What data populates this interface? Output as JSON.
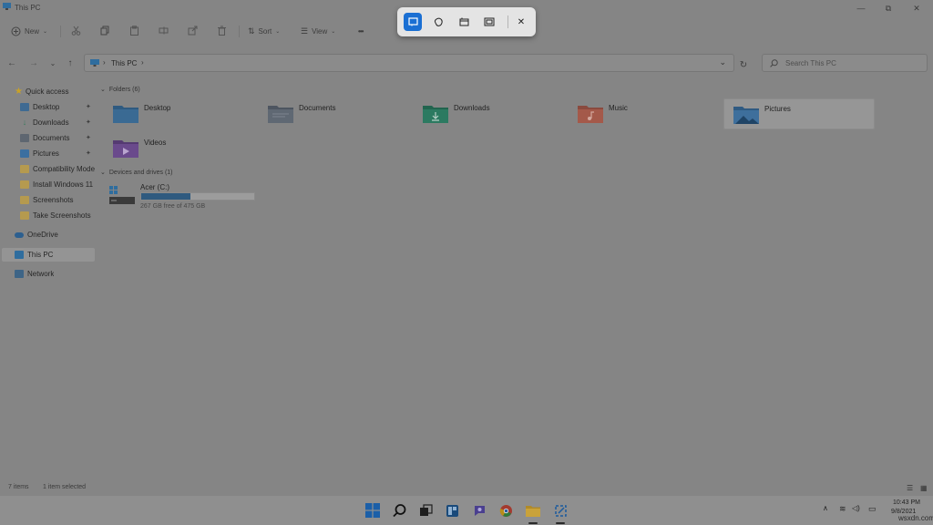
{
  "window": {
    "title": "This PC",
    "minimize_glyph": "—",
    "maximize_glyph": "⧉",
    "close_glyph": "✕"
  },
  "toolbar": {
    "new_label": "New",
    "sort_label": "Sort",
    "view_label": "View",
    "more_glyph": "•••",
    "icons": [
      "new-icon",
      "cut-icon",
      "copy-icon",
      "paste-icon",
      "rename-icon",
      "share-icon",
      "delete-icon",
      "sort-icon",
      "view-icon"
    ]
  },
  "nav": {
    "back_glyph": "←",
    "forward_glyph": "→",
    "recent_glyph": "⌄",
    "up_glyph": "↑",
    "breadcrumb": "This PC",
    "crumb_chevron": "›",
    "dropdown_glyph": "⌄",
    "refresh_glyph": "↻",
    "search_placeholder": "Search This PC"
  },
  "sidebar": {
    "quick_access": "Quick access",
    "items": [
      {
        "label": "Desktop",
        "pinned": true,
        "icon": "desktop-icon",
        "color": "#3f6a92"
      },
      {
        "label": "Downloads",
        "pinned": true,
        "icon": "download-icon",
        "color": "#3c7a5e"
      },
      {
        "label": "Documents",
        "pinned": true,
        "icon": "documents-icon",
        "color": "#5e6670"
      },
      {
        "label": "Pictures",
        "pinned": true,
        "icon": "pictures-icon",
        "color": "#3b6fa0"
      },
      {
        "label": "Compatibility Mode",
        "pinned": false,
        "icon": "folder-icon",
        "color": "#b59a4f"
      },
      {
        "label": "Install Windows 11",
        "pinned": false,
        "icon": "folder-icon",
        "color": "#b59a4f"
      },
      {
        "label": "Screenshots",
        "pinned": false,
        "icon": "folder-icon",
        "color": "#b59a4f"
      },
      {
        "label": "Take Screenshots",
        "pinned": false,
        "icon": "folder-icon",
        "color": "#b59a4f"
      }
    ],
    "onedrive": "OneDrive",
    "this_pc": "This PC",
    "network": "Network",
    "pin_glyph": "✦",
    "expand_glyph": "›",
    "collapse_glyph": "⌄"
  },
  "content": {
    "folders_header": "Folders (6)",
    "folders": [
      {
        "label": "Desktop",
        "icon": "desktop-folder-icon",
        "color": "#3a6a93",
        "selected": false
      },
      {
        "label": "Documents",
        "icon": "documents-folder-icon",
        "color": "#5f6873",
        "selected": false
      },
      {
        "label": "Downloads",
        "icon": "downloads-folder-icon",
        "color": "#2c7a61",
        "selected": false
      },
      {
        "label": "Music",
        "icon": "music-folder-icon",
        "color": "#a4594a",
        "selected": false
      },
      {
        "label": "Pictures",
        "icon": "pictures-folder-icon",
        "color": "#3e6f9c",
        "selected": true
      },
      {
        "label": "Videos",
        "icon": "videos-folder-icon",
        "color": "#6a4a8c",
        "selected": false
      }
    ],
    "devices_header": "Devices and drives (1)",
    "drive": {
      "label": "Acer (C:)",
      "free_text": "267 GB free of 475 GB",
      "used_fraction": 0.438,
      "bar_color": "#2f5a7f"
    }
  },
  "status": {
    "items_count": "7 items",
    "selected": "1 item selected"
  },
  "snip_toolbar": {
    "modes": [
      "rectangle-snip-icon",
      "freeform-snip-icon",
      "window-snip-icon",
      "fullscreen-snip-icon"
    ],
    "close_glyph": "✕",
    "accent": "#1a6fd3"
  },
  "taskbar": {
    "apps": [
      "windows-start-icon",
      "search-icon",
      "task-view-icon",
      "widgets-icon",
      "chat-icon",
      "chrome-icon",
      "file-explorer-icon",
      "snipping-tool-icon"
    ],
    "tray_up_glyph": "∧",
    "wifi_glyph": "≋",
    "volume_glyph": "◁)",
    "battery_glyph": "▭",
    "time": "10:43 PM",
    "date": "9/8/2021"
  },
  "watermark": "wsxdn.com"
}
